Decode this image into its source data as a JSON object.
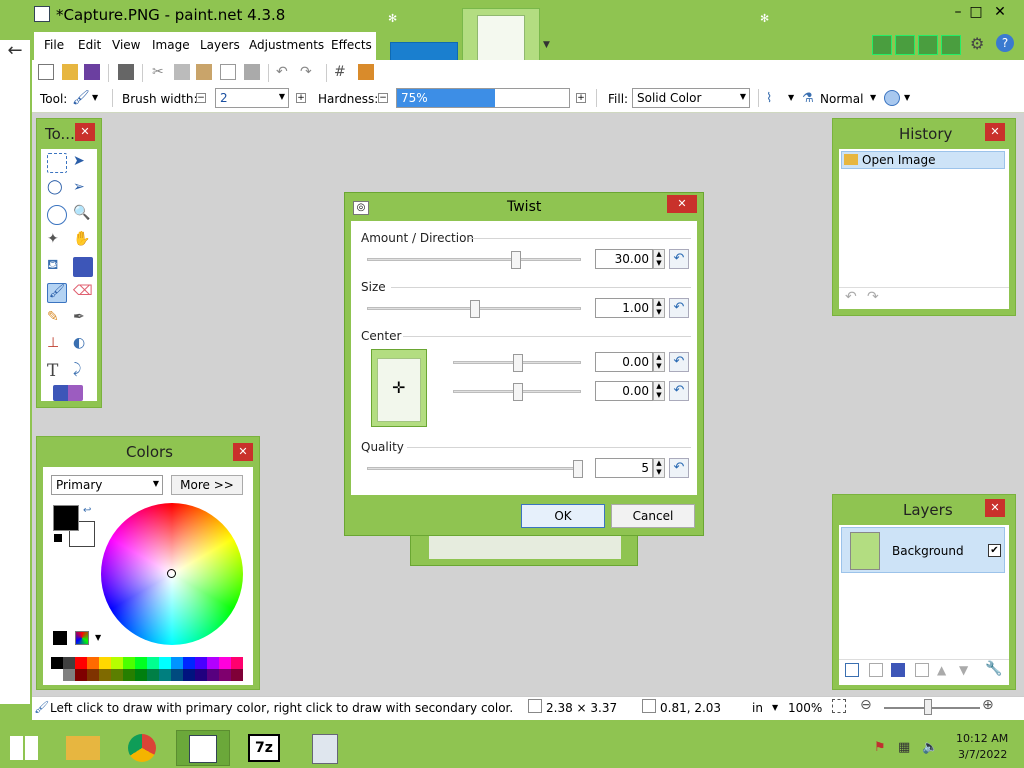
{
  "window": {
    "title": "*Capture.PNG - paint.net 4.3.8",
    "minimize": "–",
    "maximize": "□",
    "close": "✕"
  },
  "menu": {
    "items": [
      "File",
      "Edit",
      "View",
      "Image",
      "Layers",
      "Adjustments",
      "Effects"
    ]
  },
  "toolbar": {
    "tool_label": "Tool:",
    "brush_width_label": "Brush width:",
    "brush_width_value": "2",
    "hardness_label": "Hardness:",
    "hardness_value": "75%",
    "hardness_fraction": 0.75,
    "fill_label": "Fill:",
    "fill_value": "Solid Color",
    "blend_value": "Normal"
  },
  "tools_panel": {
    "title": "To..."
  },
  "history_panel": {
    "title": "History",
    "items": [
      "Open Image"
    ]
  },
  "colors_panel": {
    "title": "Colors",
    "select_value": "Primary",
    "more_button": "More >>",
    "primary_color": "#000000",
    "secondary_color": "#ffffff",
    "palette_top": [
      "#000000",
      "#404040",
      "#ff0000",
      "#ff6a00",
      "#ffd800",
      "#b6ff00",
      "#4cff00",
      "#00ff21",
      "#00ff90",
      "#00ffff",
      "#0094ff",
      "#0026ff",
      "#4800ff",
      "#b200ff",
      "#ff00dc",
      "#ff006e"
    ],
    "palette_bottom": [
      "#ffffff",
      "#808080",
      "#7f0000",
      "#7f3300",
      "#7f6a00",
      "#5b7f00",
      "#267f00",
      "#007f0e",
      "#007f46",
      "#007f7f",
      "#004a7f",
      "#00137f",
      "#21007f",
      "#57007f",
      "#7f006e",
      "#7f0037"
    ]
  },
  "layers_panel": {
    "title": "Layers",
    "items": [
      {
        "name": "Background",
        "visible": true
      }
    ]
  },
  "twist_dialog": {
    "title": "Twist",
    "amount_label": "Amount / Direction",
    "amount_value": "30.00",
    "size_label": "Size",
    "size_value": "1.00",
    "center_label": "Center",
    "center_x": "0.00",
    "center_y": "0.00",
    "quality_label": "Quality",
    "quality_value": "5",
    "ok": "OK",
    "cancel": "Cancel"
  },
  "statusbar": {
    "hint": "Left click to draw with primary color, right click to draw with secondary color.",
    "size": "2.38 × 3.37",
    "position": "0.81, 2.03",
    "units": "in",
    "zoom": "100%"
  },
  "taskbar": {
    "time": "10:12 AM",
    "date": "3/7/2022",
    "apps": [
      "file-explorer",
      "chrome",
      "paint-net",
      "7zip",
      "calculator"
    ]
  }
}
